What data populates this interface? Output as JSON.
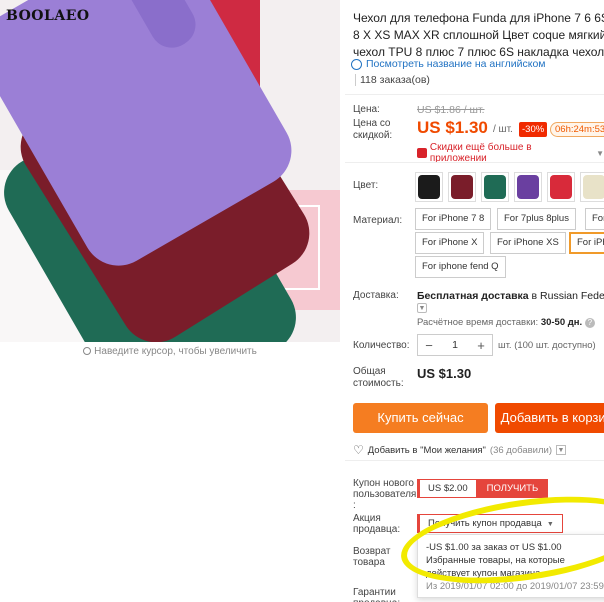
{
  "gallery": {
    "brand": "BOOLAEO",
    "zoom_hint": "Наведите курсор, чтобы увеличить"
  },
  "product": {
    "title": "Чехол для телефона Funda для iPhone 7 6 6S 8 X XS MAX XR сплошной Цвет coque мягкий чехол TPU 8 плюс 7 плюс 6S накладка чехол",
    "translate_link": "Посмотреть название на английском",
    "orders": "118 заказа(ов)"
  },
  "price": {
    "label_price": "Цена:",
    "old_price": "US $1.86 / шт.",
    "label_discount": "Цена со скидкой:",
    "new_price": "US $1.30",
    "per_unit": "/ шт.",
    "discount_badge": "-30%",
    "timer": "06h:24m:53s",
    "app_deal": "Скидки ещё больше в приложении"
  },
  "color": {
    "label": "Цвет:",
    "swatches": [
      "#1b1b1b",
      "#7a1d2a",
      "#1f6b55",
      "#6a3fa0",
      "#d82a3a",
      "#e8e2c8"
    ]
  },
  "material": {
    "label": "Материал:",
    "options": [
      "For iPhone 7 8",
      "For 7plus 8plus",
      "For",
      "For iPhone X",
      "For iPhone XS",
      "For iPh",
      "For iphone fend Q"
    ]
  },
  "shipping": {
    "label": "Доставка:",
    "free": "Бесплатная доставка",
    "to": "в",
    "country": "Russian Federation",
    "time_label": "Расчётное время доставки:",
    "time_value": "30-50 дн.",
    "help": "?"
  },
  "quantity": {
    "label": "Количество:",
    "minus": "−",
    "value": "1",
    "plus": "+",
    "note": "шт. (100 шт. доступно)"
  },
  "total": {
    "label": "Общая стоимость:",
    "value": "US $1.30"
  },
  "actions": {
    "buy": "Купить сейчас",
    "cart": "Добавить в корзину",
    "wishlist": "Добавить в \"Мои желания\"",
    "wishlist_count": "(36 добавили)"
  },
  "coupons": {
    "new_user_label": "Купон нового пользователя :",
    "new_user_amount": "US $2.00",
    "get": "ПОЛУЧИТЬ",
    "seller_label": "Акция продавца:",
    "seller_button": "Получить купон продавца",
    "popup_line1": "-US $1.00 за заказ от US $1.00",
    "popup_line2": "Избранные товары, на которые действует купон магазина",
    "popup_dates": "Из 2019/01/07 02:00 до 2019/01/07 23:59"
  },
  "return": {
    "label": "Возврат товара"
  },
  "guarantee": {
    "label": "Гарантии продавца:"
  }
}
